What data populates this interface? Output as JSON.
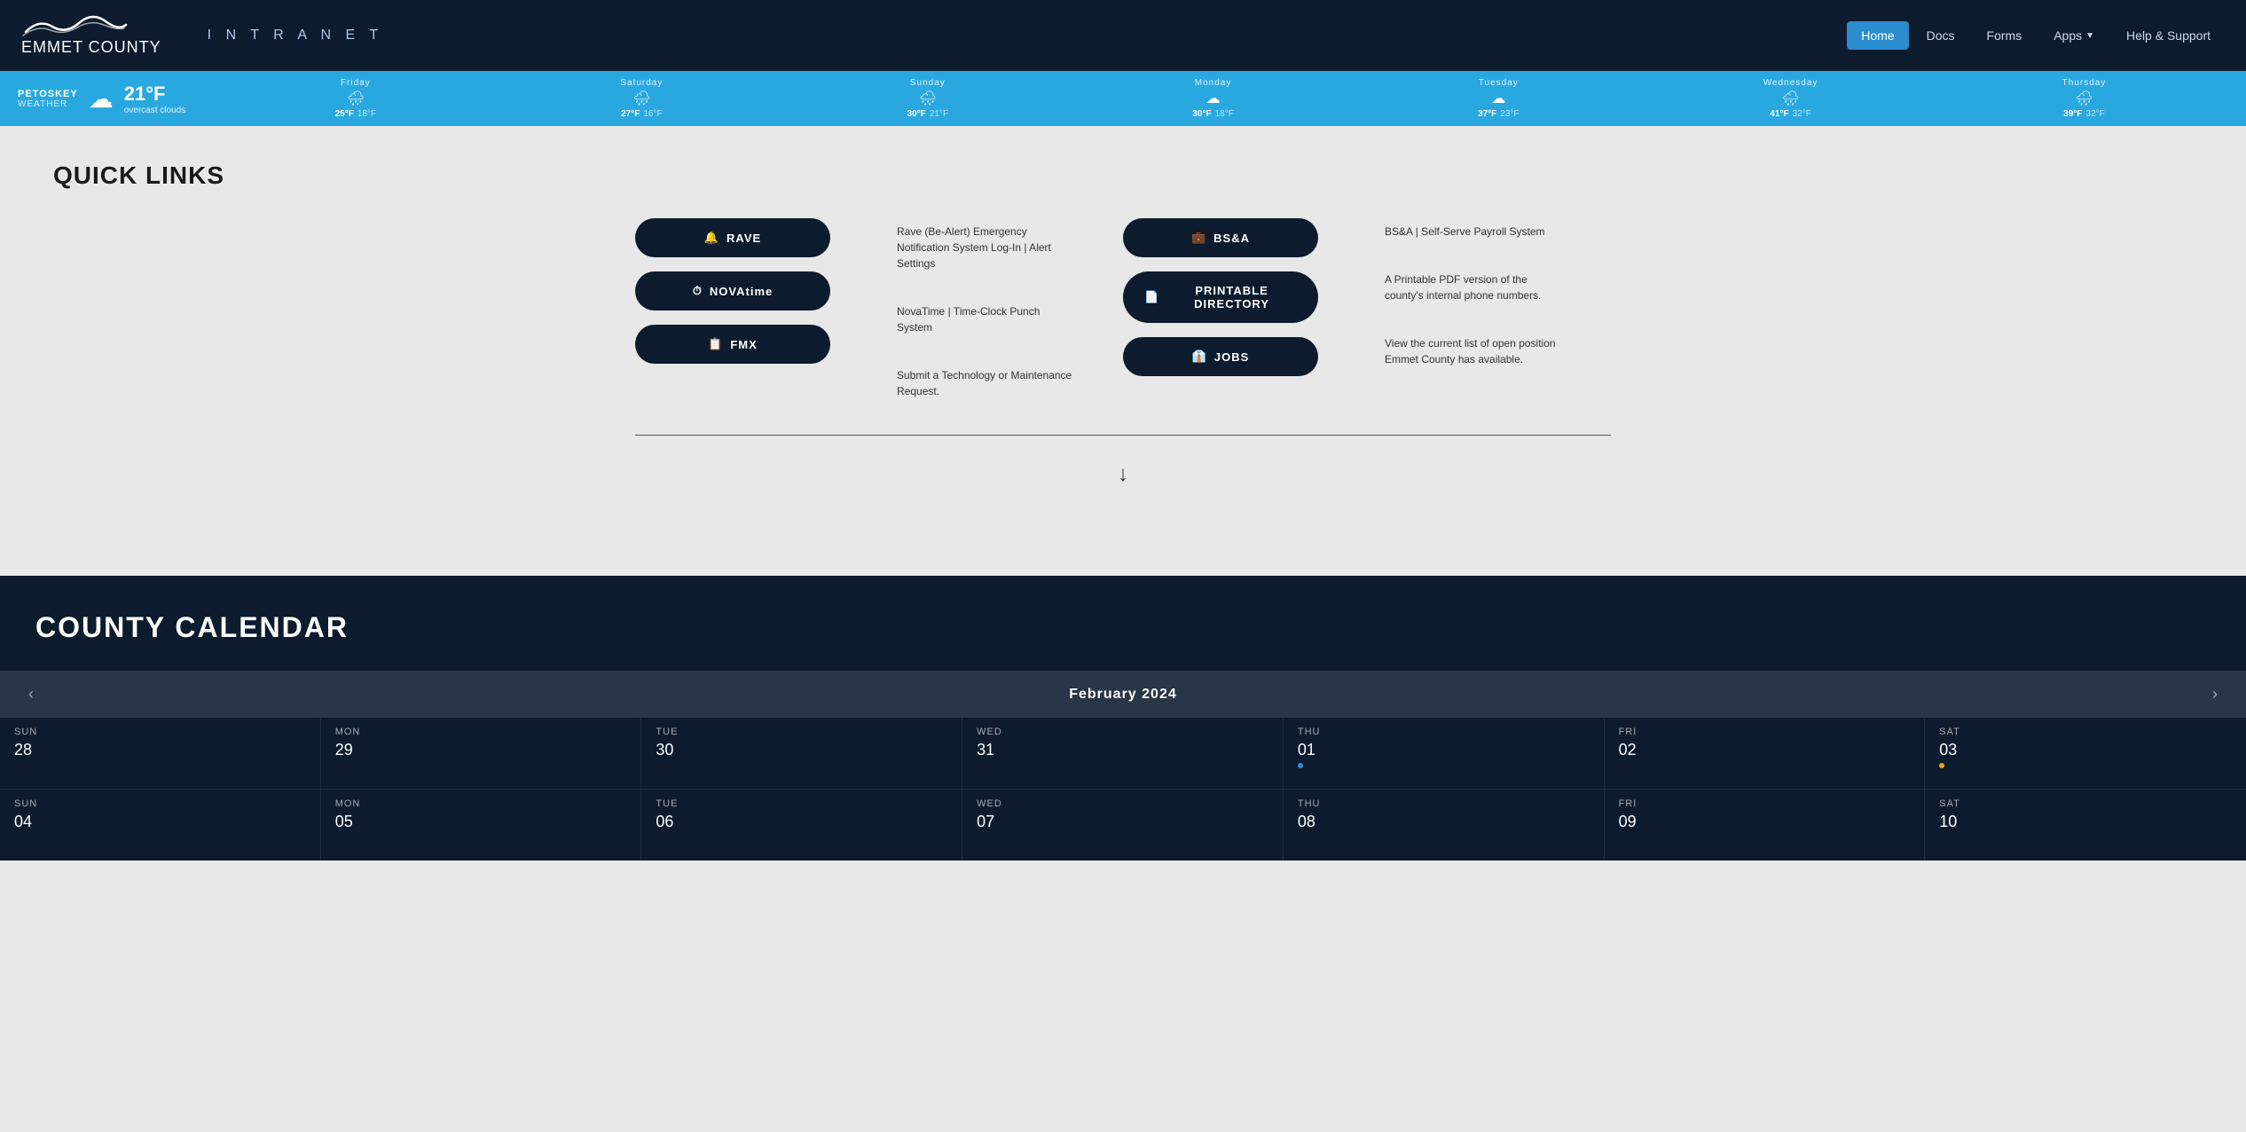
{
  "navbar": {
    "logo_bold": "EMMET",
    "logo_light": " COUNTY",
    "intranet": "I N T R A N E T",
    "nav_items": [
      {
        "label": "Home",
        "active": true
      },
      {
        "label": "Docs",
        "active": false
      },
      {
        "label": "Forms",
        "active": false
      },
      {
        "label": "Apps",
        "active": false,
        "has_caret": true
      },
      {
        "label": "Help & Support",
        "active": false
      }
    ]
  },
  "weather": {
    "city": "PETOSKEY",
    "label": "WEATHER",
    "current_temp": "21°F",
    "current_desc": "overcast clouds",
    "forecast": [
      {
        "day": "Friday",
        "icon": "🌧",
        "high": "25°F",
        "low": "18°F"
      },
      {
        "day": "Saturday",
        "icon": "🌧",
        "high": "27°F",
        "low": "16°F"
      },
      {
        "day": "Sunday",
        "icon": "🌧",
        "high": "30°F",
        "low": "21°F"
      },
      {
        "day": "Monday",
        "icon": "☁",
        "high": "30°F",
        "low": "18°F"
      },
      {
        "day": "Tuesday",
        "icon": "☁",
        "high": "37°F",
        "low": "23°F"
      },
      {
        "day": "Wednesday",
        "icon": "🌧",
        "high": "41°F",
        "low": "32°F"
      },
      {
        "day": "Thursday",
        "icon": "🌧",
        "high": "39°F",
        "low": "32°F"
      }
    ]
  },
  "quick_links": {
    "title": "QUICK LINKS",
    "buttons_left": [
      {
        "label": "RAVE",
        "icon": "🔔"
      },
      {
        "label": "NOVAtime",
        "icon": "⏱"
      },
      {
        "label": "FMX",
        "icon": "📋"
      }
    ],
    "descs_left": [
      "Rave (Be-Alert) Emergency Notification System Log-In | Alert Settings",
      "NovaTime | Time-Clock Punch System",
      "Submit a Technology or Maintenance Request."
    ],
    "buttons_right": [
      {
        "label": "BS&A",
        "icon": "💼"
      },
      {
        "label": "PRINTABLE DIRECTORY",
        "icon": "📄"
      },
      {
        "label": "JOBS",
        "icon": "👔"
      }
    ],
    "descs_right": [
      "BS&A | Self-Serve Payroll System",
      "A Printable PDF version of the county's internal phone numbers.",
      "View the current list of open position Emmet County has available."
    ]
  },
  "calendar": {
    "title": "COUNTY CALENDAR",
    "month_year": "February 2024",
    "row1": [
      {
        "day_name": "SUN",
        "day_num": "28",
        "dot": false,
        "today": false
      },
      {
        "day_name": "MON",
        "day_num": "29",
        "dot": false,
        "today": false
      },
      {
        "day_name": "TUE",
        "day_num": "30",
        "dot": false,
        "today": false
      },
      {
        "day_name": "WED",
        "day_num": "31",
        "dot": false,
        "today": false
      },
      {
        "day_name": "THU",
        "day_num": "01",
        "dot": true,
        "dot_color": "blue",
        "today": false
      },
      {
        "day_name": "FRI",
        "day_num": "02",
        "dot": false,
        "today": false
      },
      {
        "day_name": "SAT",
        "day_num": "03",
        "dot": true,
        "dot_color": "yellow",
        "today": false
      }
    ],
    "row2": [
      {
        "day_name": "SUN",
        "day_num": "04",
        "dot": false,
        "today": false
      },
      {
        "day_name": "MON",
        "day_num": "05",
        "dot": false,
        "today": false
      },
      {
        "day_name": "TUE",
        "day_num": "06",
        "dot": false,
        "today": false
      },
      {
        "day_name": "WED",
        "day_num": "07",
        "dot": false,
        "today": false
      },
      {
        "day_name": "THU",
        "day_num": "08",
        "dot": false,
        "today": false
      },
      {
        "day_name": "FRI",
        "day_num": "09",
        "dot": false,
        "today": false
      },
      {
        "day_name": "SAT",
        "day_num": "10",
        "dot": false,
        "today": false
      }
    ]
  }
}
